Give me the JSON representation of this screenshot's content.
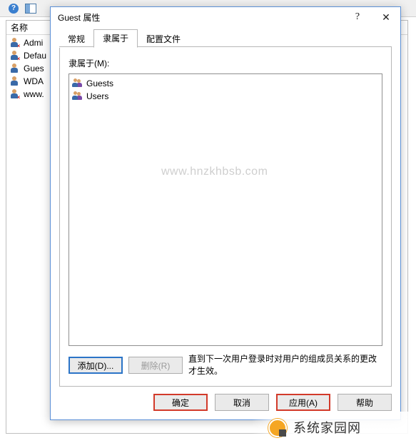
{
  "toolbar": {
    "help_glyph": "?",
    "layout_name": "layout-icon"
  },
  "bg_panel": {
    "header": "名称",
    "items": [
      {
        "label": "Admi",
        "disabled": true
      },
      {
        "label": "Defau",
        "disabled": true
      },
      {
        "label": "Gues",
        "disabled": false
      },
      {
        "label": "WDA",
        "disabled": false
      },
      {
        "label": "www.",
        "disabled": true
      }
    ]
  },
  "dialog": {
    "title": "Guest 属性",
    "help_glyph": "?",
    "close_glyph": "✕",
    "tabs": [
      {
        "label": "常规",
        "active": false
      },
      {
        "label": "隶属于",
        "active": true
      },
      {
        "label": "配置文件",
        "active": false
      }
    ],
    "member_of_label": "隶属于(M):",
    "members": [
      {
        "label": "Guests"
      },
      {
        "label": "Users"
      }
    ],
    "add_label": "添加(D)...",
    "remove_label": "删除(R)",
    "hint": "直到下一次用户登录时对用户的组成员关系的更改才生效。",
    "ok_label": "确定",
    "cancel_label": "取消",
    "apply_label": "应用(A)",
    "help_label": "帮助"
  },
  "watermark": "www.hnzkhbsb.com",
  "logo_text": "系统家园网"
}
